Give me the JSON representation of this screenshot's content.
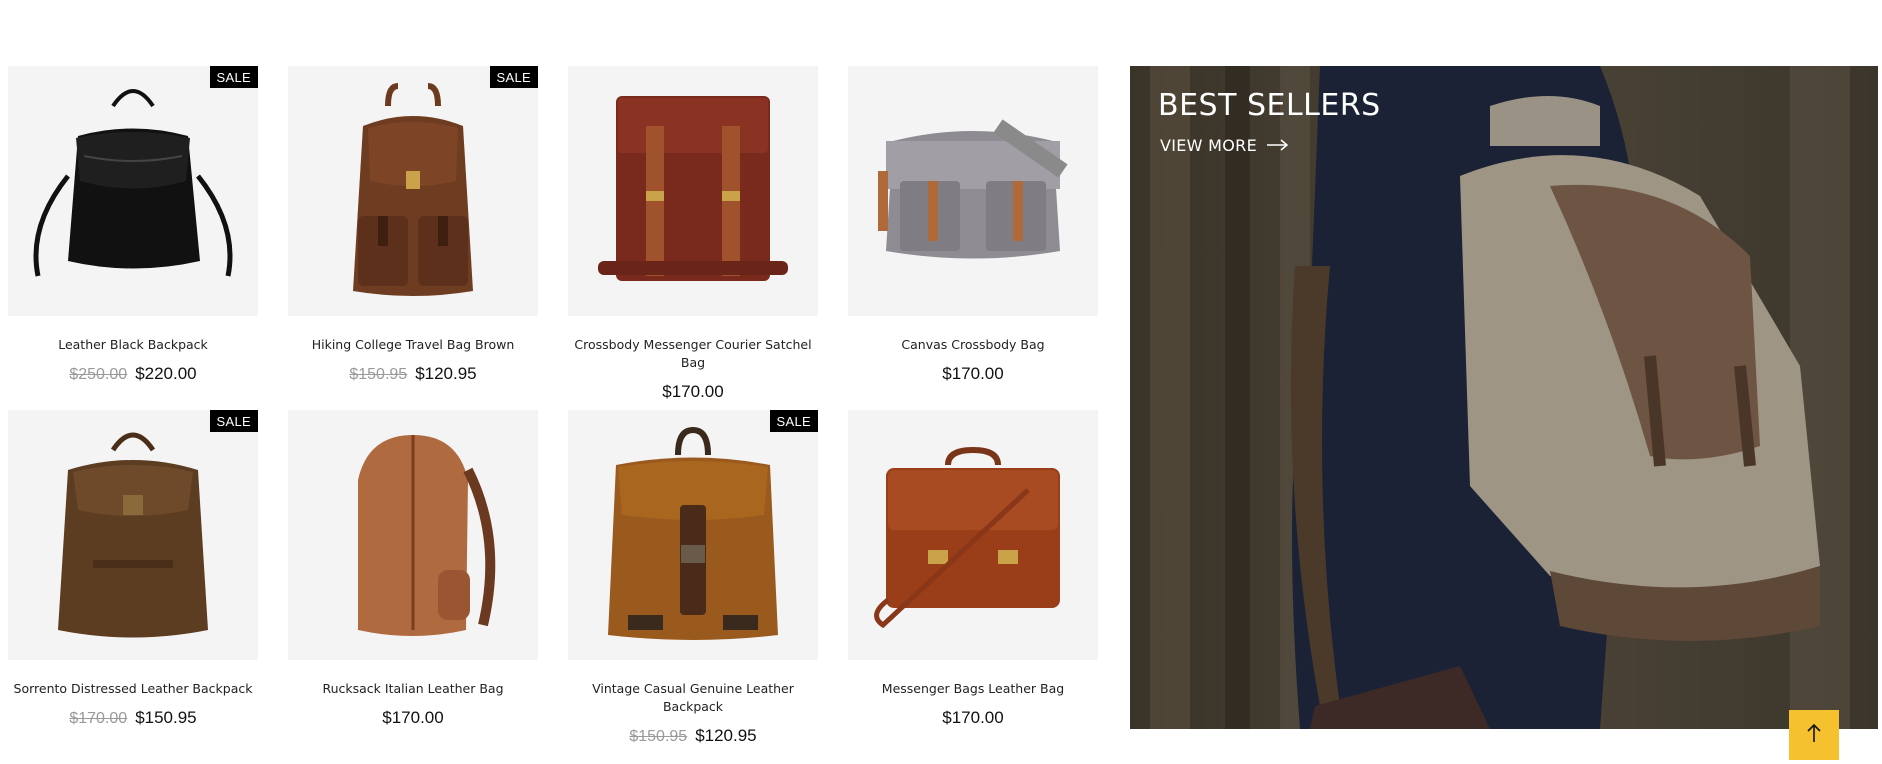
{
  "products": [
    {
      "name": "Leather Black Backpack",
      "old_price": "$250.00",
      "price": "$220.00",
      "sale": "SALE",
      "icon": "black-backpack-image"
    },
    {
      "name": "Hiking College Travel Bag Brown",
      "old_price": "$150.95",
      "price": "$120.95",
      "sale": "SALE",
      "icon": "brown-travel-backpack-image"
    },
    {
      "name": "Crossbody Messenger Courier Satchel Bag",
      "old_price": "",
      "price": "$170.00",
      "sale": "",
      "icon": "satchel-bag-image"
    },
    {
      "name": "Canvas Crossbody Bag",
      "old_price": "",
      "price": "$170.00",
      "sale": "",
      "icon": "canvas-messenger-bag-image"
    },
    {
      "name": "Sorrento Distressed Leather Backpack",
      "old_price": "$170.00",
      "price": "$150.95",
      "sale": "SALE",
      "icon": "distressed-backpack-image"
    },
    {
      "name": "Rucksack Italian Leather Bag",
      "old_price": "",
      "price": "$170.00",
      "sale": "",
      "icon": "tan-rucksack-image"
    },
    {
      "name": "Vintage Casual Genuine Leather Backpack",
      "old_price": "$150.95",
      "price": "$120.95",
      "sale": "SALE",
      "icon": "vintage-backpack-image"
    },
    {
      "name": "Messenger Bags Leather Bag",
      "old_price": "",
      "price": "$170.00",
      "sale": "",
      "icon": "leather-briefcase-image"
    }
  ],
  "banner": {
    "title": "BEST SELLERS",
    "link": "VIEW MORE",
    "icon": "arrow-right-icon"
  },
  "scroll_top": {
    "icon": "arrow-up-icon",
    "color": "#f5c12e"
  },
  "colors": {
    "sale_badge": "#000000",
    "old_price": "#9a9a9a",
    "image_bg": "#f4f4f4"
  }
}
